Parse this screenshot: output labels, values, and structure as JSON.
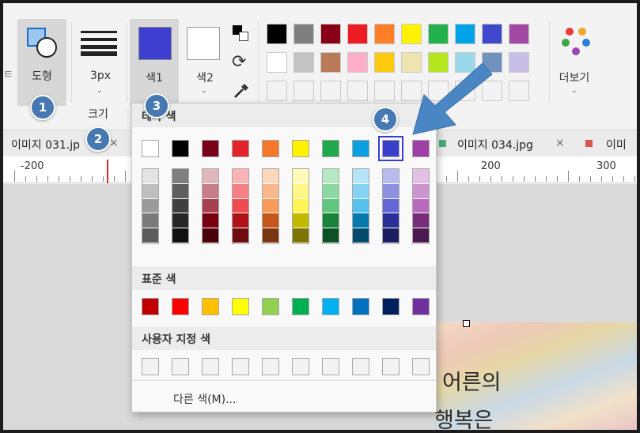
{
  "ribbon": {
    "shape_label": "도형",
    "size_value": "3px",
    "size_label": "크기",
    "color1_label": "색1",
    "color2_label": "색2",
    "more_label": "더보기",
    "color1_value": "#3e3fd0",
    "color2_value": "#ffffff",
    "palette_row1": [
      "#000000",
      "#7f7f7f",
      "#880015",
      "#ed1c24",
      "#ff7f27",
      "#fff200",
      "#22b14c",
      "#00a2e8",
      "#3f48cc",
      "#a349a4"
    ],
    "palette_row2": [
      "#ffffff",
      "#c3c3c3",
      "#b97a57",
      "#ffaec9",
      "#ffc90e",
      "#efe4b0",
      "#b5e61d",
      "#99d9ea",
      "#7092be",
      "#c8bfe7"
    ],
    "palette_row3": [
      "#f3f3f3",
      "#f3f3f3",
      "#f3f3f3",
      "#f3f3f3",
      "#f3f3f3",
      "#f3f3f3",
      "#f3f3f3",
      "#f3f3f3",
      "#f3f3f3",
      "#f3f3f3"
    ]
  },
  "tabs": {
    "tab1": "이미지 031.jp",
    "tab2": "이미지 034.jpg",
    "tab3": "이미",
    "close": "×"
  },
  "ruler": {
    "n1": "-200",
    "n2": "200",
    "n3": "300"
  },
  "canvas": {
    "text1": "어른의",
    "text2": "행복은"
  },
  "dropdown": {
    "theme_header": "테마 색",
    "standard_header": "표준 색",
    "custom_header": "사용자 지정 색",
    "more_colors": "다른 색(M)...",
    "theme_colors": [
      "#ffffff",
      "#000000",
      "#7a0019",
      "#e3222b",
      "#f5772a",
      "#fff200",
      "#1fa94b",
      "#0aa0e2",
      "#3a3fc9",
      "#9e3ea6"
    ],
    "shade_columns": [
      [
        "#e3e3e3",
        "#bfbfbf",
        "#9b9b9b",
        "#7a7a7a",
        "#5c5c5c"
      ],
      [
        "#7f7f7f",
        "#5e5e5e",
        "#3f3f3f",
        "#262626",
        "#111111"
      ],
      [
        "#e0b6bd",
        "#c77c89",
        "#a9404f",
        "#78000f",
        "#4a0009"
      ],
      [
        "#f8b4b6",
        "#f48085",
        "#ef4c52",
        "#b01219",
        "#6e0b0f"
      ],
      [
        "#fbd7bb",
        "#f9b88a",
        "#f79a58",
        "#c6561b",
        "#7a3511"
      ],
      [
        "#fffab7",
        "#fff686",
        "#fff454",
        "#c3b800",
        "#7c7500"
      ],
      [
        "#b8e7c6",
        "#8cd7a2",
        "#5fc77e",
        "#18833a",
        "#0e5124"
      ],
      [
        "#b6e4f7",
        "#86d2f2",
        "#56c0ee",
        "#0479ab",
        "#034b6b"
      ],
      [
        "#b8bbee",
        "#8d91e1",
        "#6368d6",
        "#2a2f97",
        "#1a1d5e"
      ],
      [
        "#e2c0e4",
        "#cd95d0",
        "#b86bbc",
        "#772c7a",
        "#4a1b4c"
      ]
    ],
    "standard_colors": [
      "#c00000",
      "#ff0000",
      "#ffc000",
      "#ffff00",
      "#92d050",
      "#00b050",
      "#00b0f0",
      "#0070c0",
      "#002060",
      "#7030a0"
    ],
    "custom_colors": [
      "#f3f3f3",
      "#f3f3f3",
      "#f3f3f3",
      "#f3f3f3",
      "#f3f3f3",
      "#f3f3f3",
      "#f3f3f3",
      "#f3f3f3",
      "#f3f3f3",
      "#f3f3f3"
    ]
  },
  "badges": [
    "1",
    "2",
    "3",
    "4"
  ],
  "colors": {
    "badge": "#4679b2",
    "arrow": "#4b86c4",
    "selection": "#3a3fc9"
  }
}
